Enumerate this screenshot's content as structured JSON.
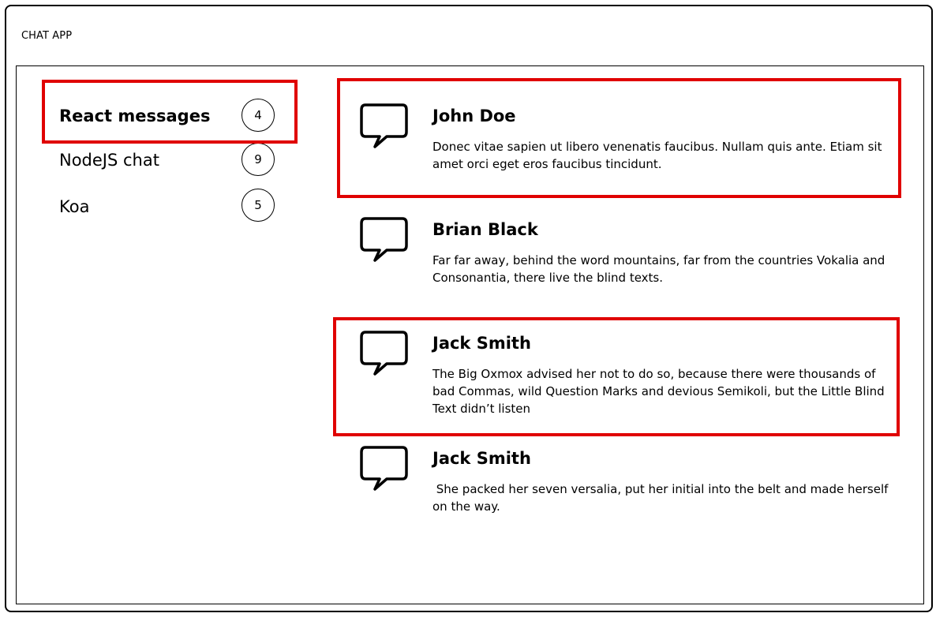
{
  "app": {
    "title": "CHAT APP"
  },
  "channels": [
    {
      "label": "React messages",
      "count": "4",
      "active": true
    },
    {
      "label": "NodeJS chat",
      "count": "9",
      "active": false
    },
    {
      "label": "Koa",
      "count": "5",
      "active": false
    }
  ],
  "messages": [
    {
      "author": "John Doe",
      "text": "Donec vitae sapien ut libero venenatis faucibus. Nullam quis ante. Etiam sit amet orci eget eros faucibus tincidunt.",
      "highlighted": true
    },
    {
      "author": "Brian Black",
      "text": "Far far away, behind the word mountains, far from the countries Vokalia and Consonantia, there live the blind texts.",
      "highlighted": false
    },
    {
      "author": "Jack Smith",
      "text": "The Big Oxmox advised her not to do so, because there were thousands of bad Commas, wild Question Marks and devious Semikoli, but the Little Blind Text didn’t listen",
      "highlighted": true
    },
    {
      "author": "Jack Smith",
      "text": " She packed her seven versalia, put her initial into the belt and made herself on the way.",
      "highlighted": false
    }
  ],
  "icons": {
    "message": "speech-bubble-icon"
  },
  "colors": {
    "highlight": "#e00000",
    "border": "#000000",
    "background": "#ffffff"
  }
}
